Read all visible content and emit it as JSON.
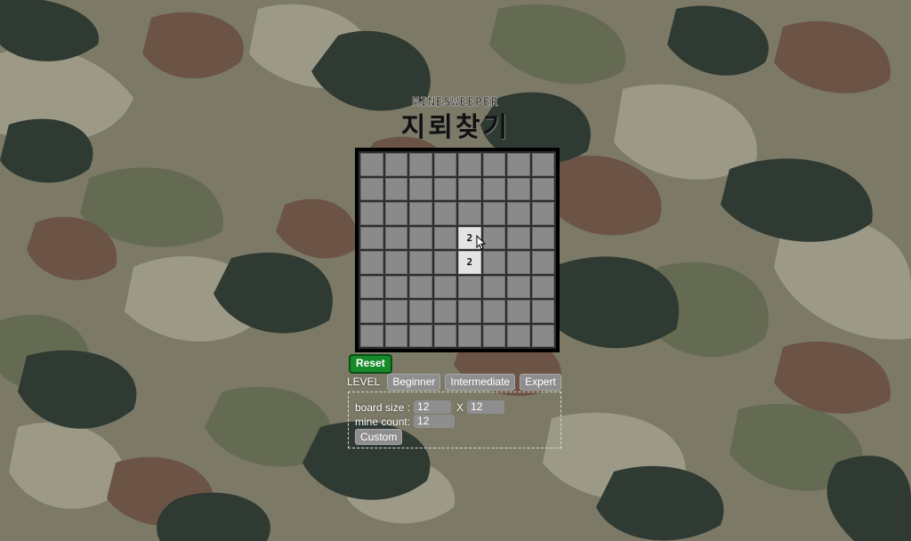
{
  "header": {
    "subtitle": "MINESWEEPER",
    "title": "지뢰찾기"
  },
  "board": {
    "rows": 8,
    "cols": 8,
    "revealed": [
      {
        "row": 3,
        "col": 4,
        "value": "2"
      },
      {
        "row": 4,
        "col": 4,
        "value": "2"
      }
    ]
  },
  "controls": {
    "reset_label": "Reset",
    "level_label": "LEVEL",
    "levels": [
      "Beginner",
      "Intermediate",
      "Expert"
    ]
  },
  "custom": {
    "board_size_label": "board size :",
    "board_size_x": "12",
    "separator": "X",
    "board_size_y": "12",
    "mine_count_label": "mine count:",
    "mine_count": "12",
    "custom_label": "Custom"
  },
  "colors": {
    "camo_base": "#7b7864",
    "camo_dark": "#2f3a33",
    "camo_brown": "#6b5446",
    "camo_light": "#9c9a87",
    "reset_green": "#178a2a"
  }
}
